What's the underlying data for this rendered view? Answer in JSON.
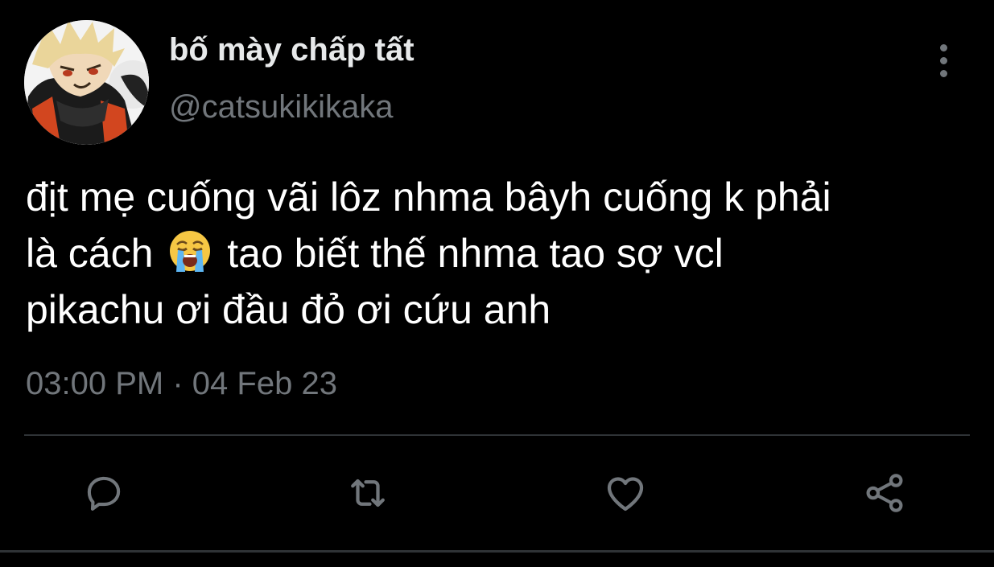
{
  "author": {
    "display_name": "bố mày chấp tất",
    "handle": "@catsukikikaka",
    "avatar_icon": "avatar-anime-character"
  },
  "tweet": {
    "lines": [
      "địt mẹ cuống vãi lôz nhma bâyh cuống k phải",
      "là cách",
      "tao biết thế nhma tao sợ vcl",
      "pikachu ơi đầu đỏ ơi cứu anh"
    ],
    "emoji": "loudly-crying-face-emoji"
  },
  "meta": {
    "time": "03:00 PM",
    "separator": "·",
    "date": "04 Feb 23"
  },
  "actions": {
    "reply_icon": "reply-icon",
    "retweet_icon": "retweet-icon",
    "like_icon": "heart-icon",
    "share_icon": "share-icon",
    "more_icon": "more-vertical-icon"
  },
  "colors": {
    "background": "#000000",
    "text_primary": "#ffffff",
    "text_secondary": "#71767b",
    "divider": "#2f3336"
  }
}
